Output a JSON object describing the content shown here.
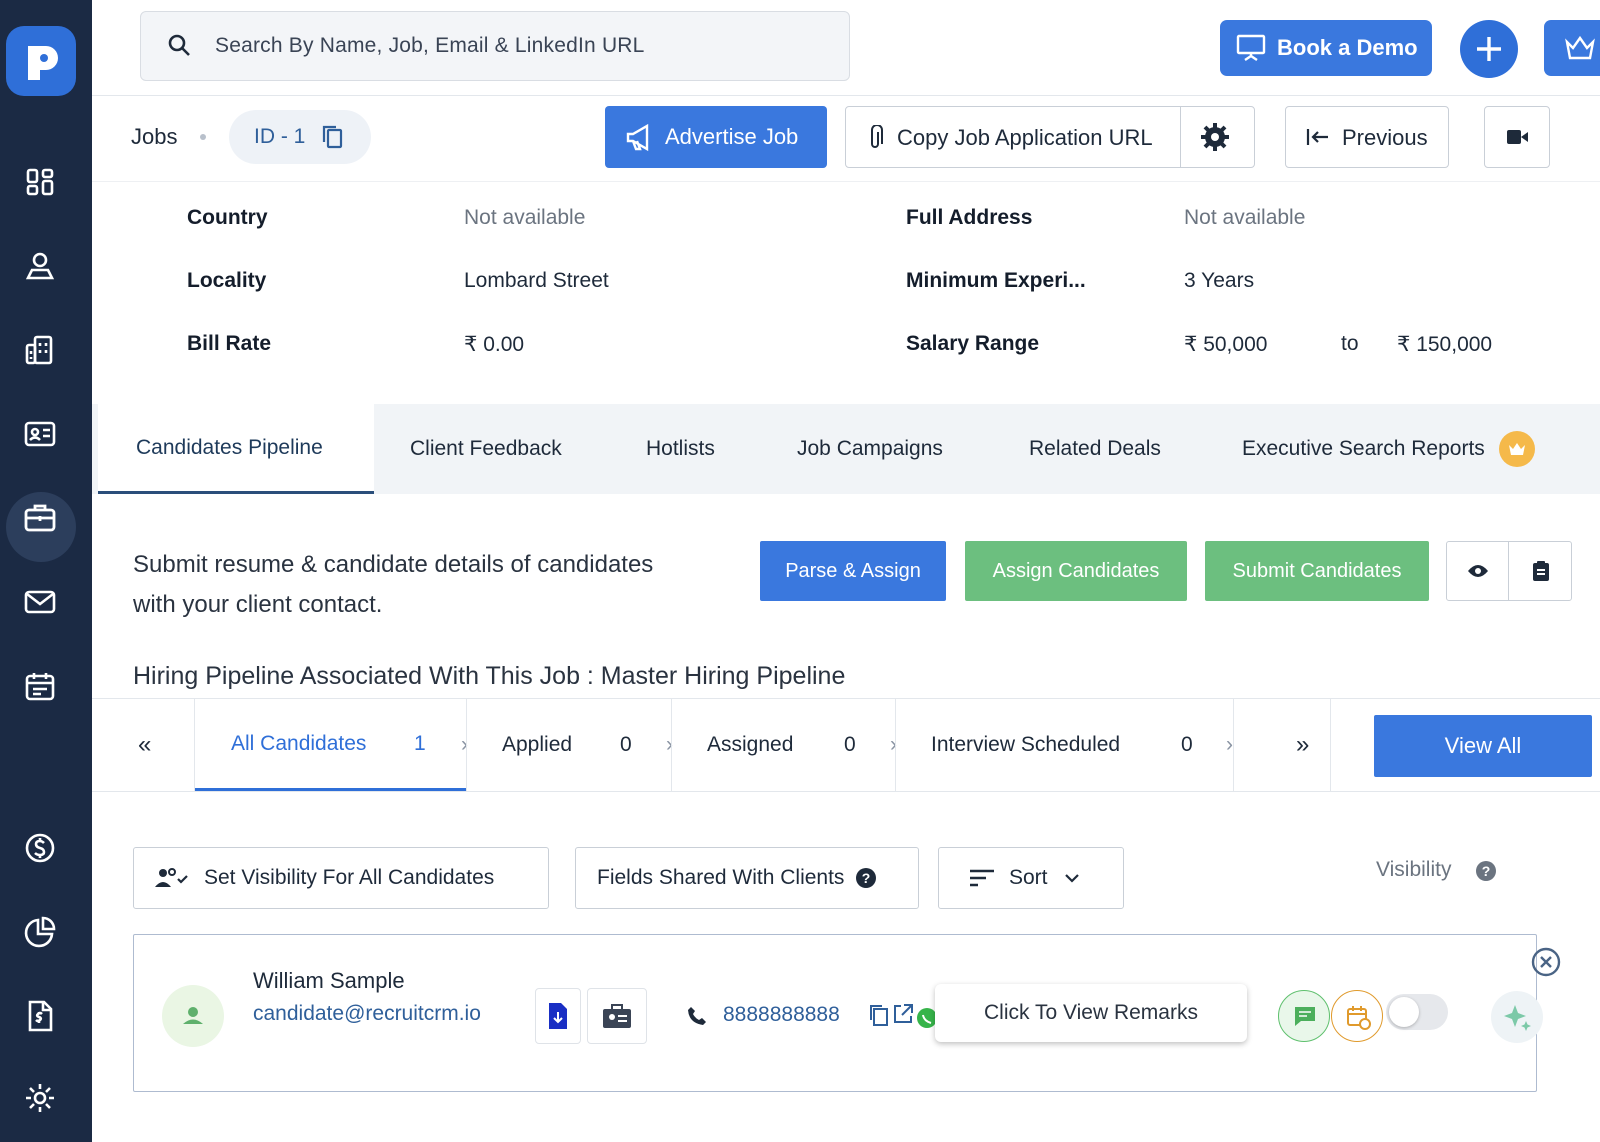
{
  "search": {
    "placeholder": "Search By Name, Job, Email & LinkedIn URL"
  },
  "header": {
    "book_demo_label": "Book a Demo"
  },
  "job_bar": {
    "breadcrumb": "Jobs",
    "id_label": "ID - 1",
    "advertise_label": "Advertise Job",
    "copy_url_label": "Copy Job Application URL",
    "previous_label": "Previous"
  },
  "details": {
    "country_label": "Country",
    "country_value": "Not available",
    "full_address_label": "Full Address",
    "full_address_value": "Not available",
    "locality_label": "Locality",
    "locality_value": "Lombard Street",
    "min_exp_label": "Minimum Experi...",
    "min_exp_value": "3 Years",
    "bill_rate_label": "Bill Rate",
    "bill_rate_value": "₹ 0.00",
    "salary_label": "Salary Range",
    "salary_from": "₹ 50,000",
    "salary_to_word": "to",
    "salary_to": "₹ 150,000"
  },
  "tabs": [
    {
      "label": "Candidates Pipeline"
    },
    {
      "label": "Client Feedback"
    },
    {
      "label": "Hotlists"
    },
    {
      "label": "Job Campaigns"
    },
    {
      "label": "Related Deals"
    },
    {
      "label": "Executive Search Reports"
    }
  ],
  "pipeline": {
    "intro_line1": "Submit resume & candidate details of candidates",
    "intro_line2": "with your client contact.",
    "parse_assign_label": "Parse & Assign",
    "assign_label": "Assign Candidates",
    "submit_label": "Submit Candidates",
    "hiring_pipeline_text": "Hiring Pipeline Associated With This Job : Master Hiring Pipeline"
  },
  "stages": {
    "prev": "«",
    "next": "»",
    "items": [
      {
        "label": "All Candidates",
        "count": "1"
      },
      {
        "label": "Applied",
        "count": "0"
      },
      {
        "label": "Assigned",
        "count": "0"
      },
      {
        "label": "Interview Scheduled",
        "count": "0"
      }
    ],
    "view_all_label": "View All"
  },
  "toolbar": {
    "visibility_all_label": "Set Visibility For All Candidates",
    "fields_shared_label": "Fields Shared With Clients",
    "sort_label": "Sort",
    "visibility_label": "Visibility"
  },
  "candidate": {
    "name": "William Sample",
    "email": "candidate@recruitcrm.io",
    "phone": "8888888888",
    "remarks_label": "Click To View Remarks"
  },
  "colors": {
    "primary": "#3a78de",
    "sidebar": "#1b2a44",
    "green": "#6cbf7f"
  }
}
